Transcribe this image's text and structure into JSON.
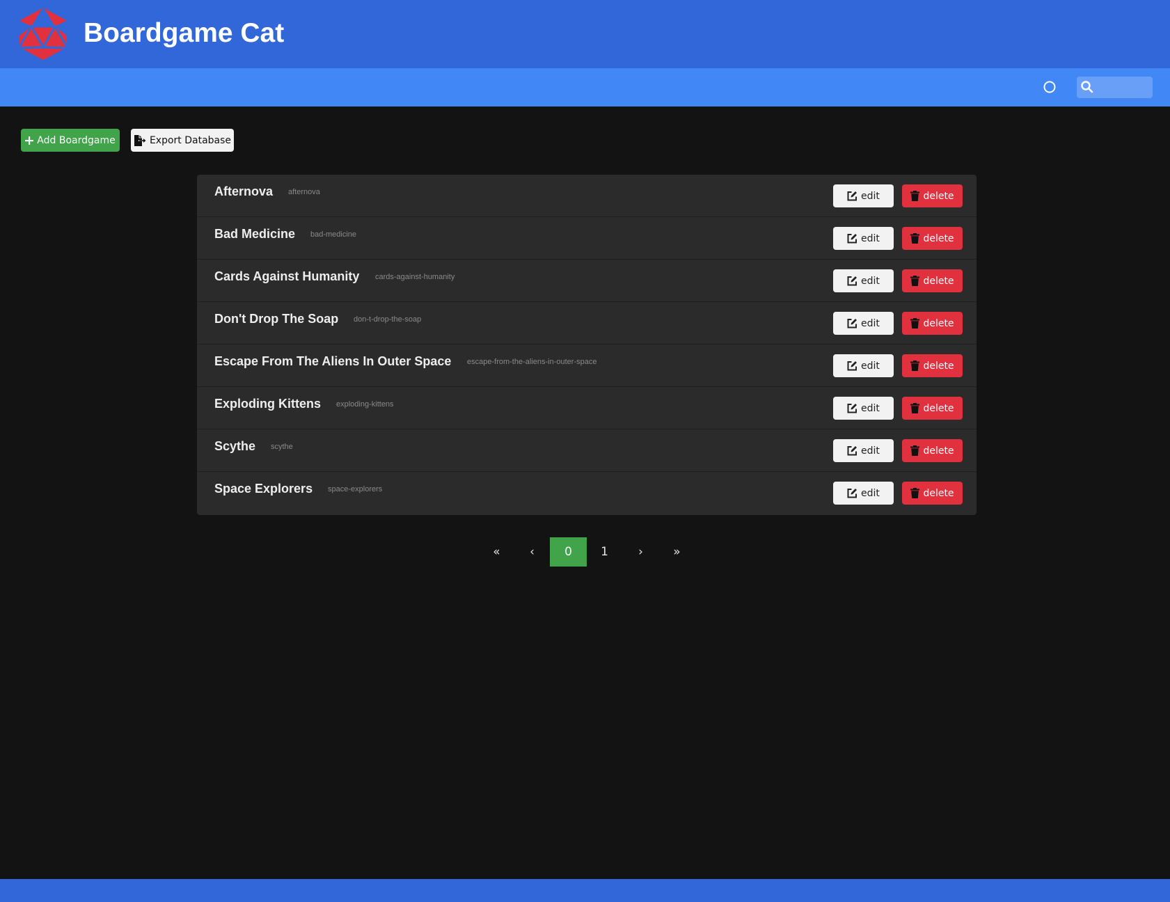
{
  "header": {
    "title": "Boardgame Cat",
    "brand_color": "#3167d8",
    "nav_color": "#4287f6",
    "logo_color": "#e1313f"
  },
  "navbar": {
    "theme_toggle_icon": "circle-icon",
    "search": {
      "icon": "search-icon",
      "value": "",
      "placeholder": ""
    }
  },
  "toolbar": {
    "add_label": "Add Boardgame",
    "add_icon": "plus-icon",
    "export_label": "Export Database",
    "export_icon": "file-export-icon"
  },
  "games": [
    {
      "title": "Afternova",
      "slug": "afternova",
      "edit_label": "edit",
      "delete_label": "delete"
    },
    {
      "title": "Bad Medicine",
      "slug": "bad-medicine",
      "edit_label": "edit",
      "delete_label": "delete"
    },
    {
      "title": "Cards Against Humanity",
      "slug": "cards-against-humanity",
      "edit_label": "edit",
      "delete_label": "delete"
    },
    {
      "title": "Don't Drop The Soap",
      "slug": "don-t-drop-the-soap",
      "edit_label": "edit",
      "delete_label": "delete"
    },
    {
      "title": "Escape From The Aliens In Outer Space",
      "slug": "escape-from-the-aliens-in-outer-space",
      "edit_label": "edit",
      "delete_label": "delete"
    },
    {
      "title": "Exploding Kittens",
      "slug": "exploding-kittens",
      "edit_label": "edit",
      "delete_label": "delete"
    },
    {
      "title": "Scythe",
      "slug": "scythe",
      "edit_label": "edit",
      "delete_label": "delete"
    },
    {
      "title": "Space Explorers",
      "slug": "space-explorers",
      "edit_label": "edit",
      "delete_label": "delete"
    }
  ],
  "pagination": {
    "first": "«",
    "prev": "‹",
    "pages": [
      "0",
      "1"
    ],
    "current": "0",
    "next": "›",
    "last": "»"
  },
  "colors": {
    "success": "#41a34a",
    "danger": "#e1313f",
    "light": "#f2f2f2",
    "background": "#131313",
    "card": "#2b2b2b"
  }
}
